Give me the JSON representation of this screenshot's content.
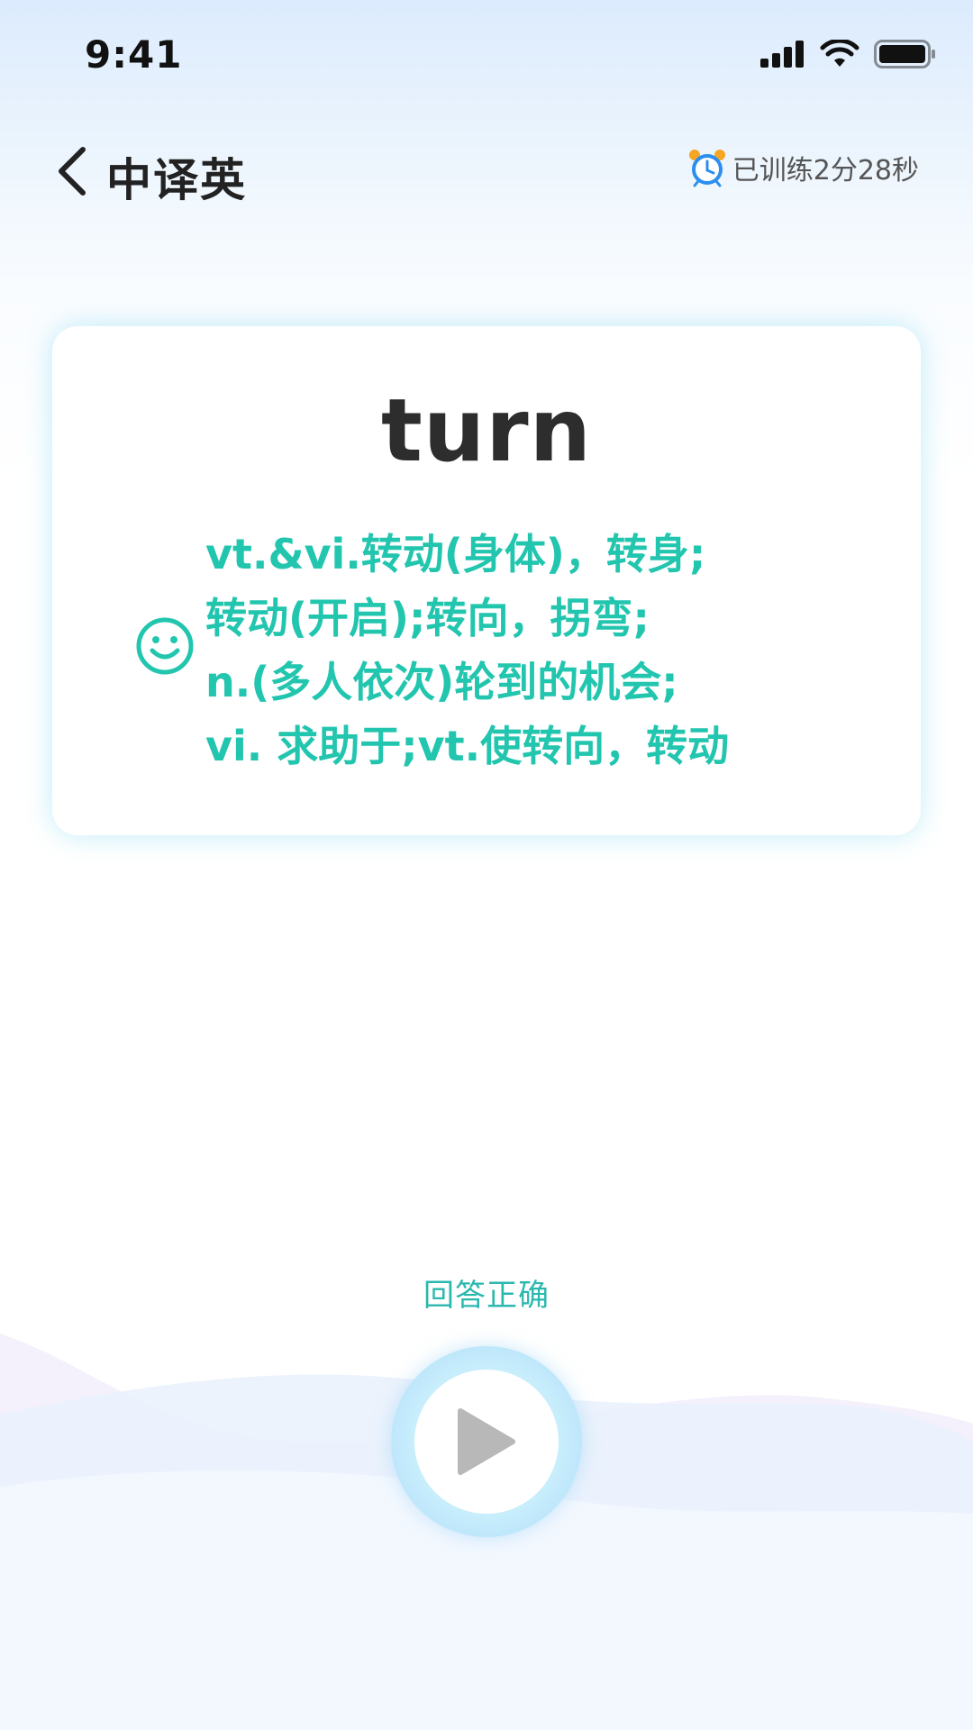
{
  "status_bar": {
    "time": "9:41"
  },
  "header": {
    "title": "中译英",
    "timer_text": "已训练2分28秒"
  },
  "card": {
    "word": "turn",
    "definitions": [
      "vt.&vi.转动(身体)，转身;",
      "转动(开启);转向，拐弯;",
      "n.(多人依次)轮到的机会;",
      "vi. 求助于;vt.使转向，转动"
    ]
  },
  "result": {
    "text": "回答正确"
  },
  "icons": {
    "back": "chevron-left-icon",
    "alarm": "alarm-clock-icon",
    "feedback": "smiley-icon",
    "play": "play-icon"
  },
  "colors": {
    "accent": "#22c5ae",
    "result": "#2bb8ae",
    "play_ring": "#bfe7fb"
  }
}
